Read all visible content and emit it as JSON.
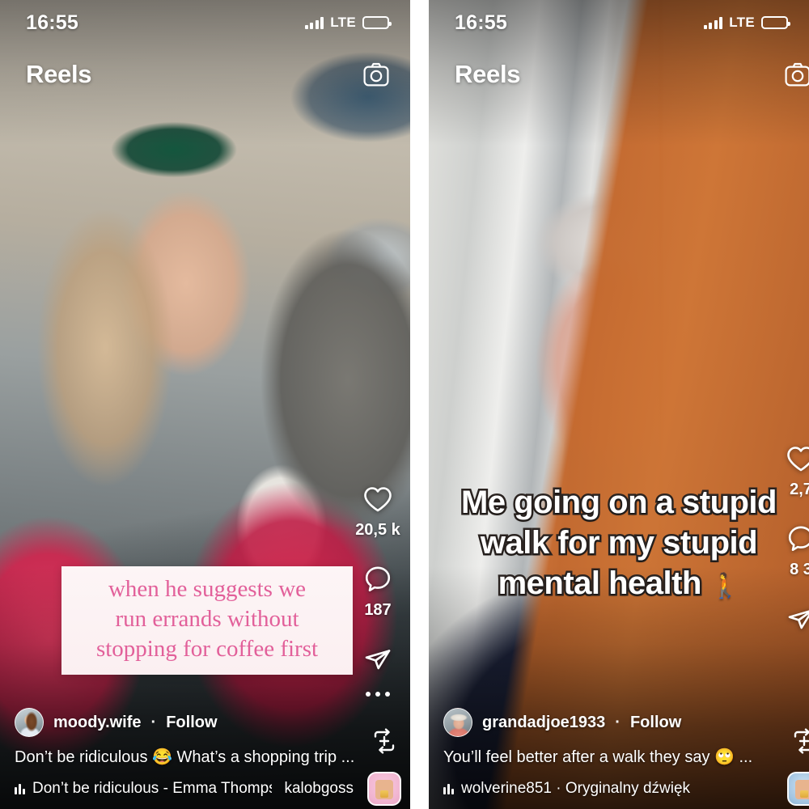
{
  "app": {
    "name": "Instagram Reels"
  },
  "panels": [
    {
      "id": "left",
      "status": {
        "clock": "16:55",
        "network": "LTE",
        "battery_level_pct": 12,
        "signal_bars": 4
      },
      "header": {
        "title": "Reels",
        "camera_icon": "camera-icon"
      },
      "overlay_sticker": {
        "lines": [
          "when he suggests we",
          "run errands without",
          "stopping for coffee first"
        ],
        "text_color": "#e2609a",
        "bg_color": "#fdf5f6"
      },
      "rail": {
        "like": {
          "icon": "heart-icon",
          "count": "20,5 k"
        },
        "comment": {
          "icon": "comment-icon",
          "count": "187"
        },
        "share": {
          "icon": "share-paperplane-icon"
        },
        "more": {
          "icon": "more-dots-icon"
        },
        "remix": {
          "icon": "remix-icon"
        },
        "audio_thumb": {
          "icon": "audio-thumbnail"
        }
      },
      "meta": {
        "avatar": "user-avatar",
        "username": "moody.wife",
        "separator": "·",
        "follow_label": "Follow",
        "caption": "Don’t be ridiculous 😂 What’s a shopping trip ...",
        "audio_icon": "audio-bars-icon",
        "audio_title": "Don’t be ridiculous - Emma Thompson",
        "audio_extra": "kalobgoss"
      }
    },
    {
      "id": "right",
      "status": {
        "clock": "16:55",
        "network": "LTE",
        "battery_level_pct": 12,
        "signal_bars": 4
      },
      "header": {
        "title": "Reels",
        "camera_icon": "camera-icon"
      },
      "overlay_meme": {
        "lines": [
          "Me going on a stupid",
          "walk for my stupid",
          "mental health"
        ],
        "emoji": "🚶",
        "text_color": "#ffffff",
        "stroke_color": "#2a2320"
      },
      "rail": {
        "like": {
          "icon": "heart-icon",
          "count": "2,7"
        },
        "comment": {
          "icon": "comment-icon",
          "count": "8 3"
        },
        "share": {
          "icon": "share-paperplane-icon"
        },
        "remix": {
          "icon": "remix-icon"
        },
        "audio_thumb": {
          "icon": "audio-thumbnail"
        }
      },
      "meta": {
        "avatar": "user-avatar",
        "username": "grandadjoe1933",
        "separator": "·",
        "follow_label": "Follow",
        "caption": "You’ll feel better after a walk they say 🙄 ...",
        "audio_icon": "audio-bars-icon",
        "audio_title": "wolverine851 · Oryginalny dźwięk",
        "audio_extra": ""
      }
    }
  ]
}
